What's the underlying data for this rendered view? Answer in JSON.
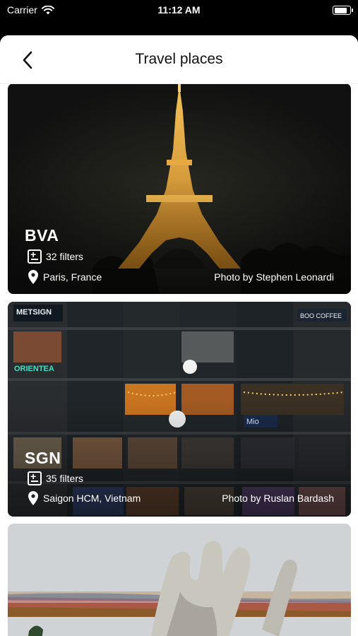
{
  "status": {
    "carrier": "Carrier",
    "time": "11:12 AM",
    "battery_level": 0.95
  },
  "nav": {
    "title": "Travel places",
    "back_icon": "chevron-left-icon"
  },
  "places": [
    {
      "code": "BVA",
      "filters": "32 filters",
      "location": "Paris, France",
      "credit": "Photo by Stephen Leonardi"
    },
    {
      "code": "SGN",
      "filters": "35 filters",
      "location": "Saigon HCM, Vietnam",
      "credit": "Photo by Ruslan Bardash"
    },
    {
      "code": "",
      "filters": "",
      "location": "",
      "credit": ""
    }
  ],
  "colors": {
    "sheet_bg": "#ffffff",
    "status_bg": "#000000",
    "text_dark": "#111111"
  }
}
